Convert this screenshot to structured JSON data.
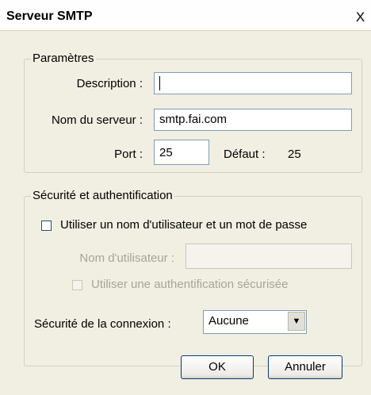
{
  "window": {
    "title": "Serveur SMTP",
    "close_glyph": "X"
  },
  "parametres": {
    "legend": "Paramètres",
    "description_label": "Description :",
    "description_value": "",
    "server_label": "Nom du serveur :",
    "server_value": "smtp.fai.com",
    "port_label": "Port :",
    "port_value": "25",
    "default_label": "Défaut :",
    "default_value": "25"
  },
  "security": {
    "legend": "Sécurité et authentification",
    "use_auth_label": "Utiliser un nom d'utilisateur et un mot de passe",
    "use_auth_checked": false,
    "username_label": "Nom d'utilisateur :",
    "username_value": "",
    "secure_auth_label": "Utiliser une authentification sécurisée",
    "secure_auth_checked": false,
    "connection_label": "Sécurité de la connexion :",
    "connection_value": "Aucune"
  },
  "buttons": {
    "ok": "OK",
    "cancel": "Annuler"
  }
}
